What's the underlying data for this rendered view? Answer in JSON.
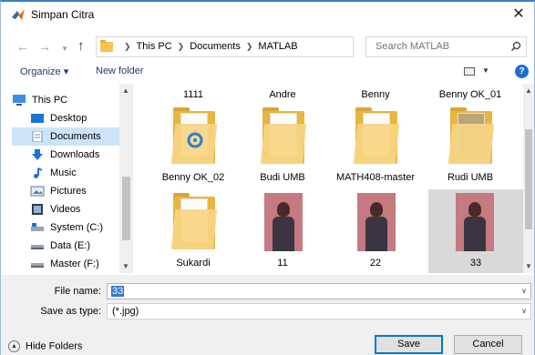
{
  "window": {
    "title": "Simpan Citra"
  },
  "address": {
    "crumbs": [
      "This PC",
      "Documents",
      "MATLAB"
    ],
    "search_placeholder": "Search MATLAB"
  },
  "toolbar": {
    "organize_label": "Organize ▾",
    "new_folder_label": "New folder"
  },
  "nav": {
    "items": [
      {
        "label": "This PC"
      },
      {
        "label": "Desktop"
      },
      {
        "label": "Documents"
      },
      {
        "label": "Downloads"
      },
      {
        "label": "Music"
      },
      {
        "label": "Pictures"
      },
      {
        "label": "Videos"
      },
      {
        "label": "System (C:)"
      },
      {
        "label": "Data (E:)"
      },
      {
        "label": "Master (F:)"
      }
    ]
  },
  "files": {
    "top_row_labels": [
      "1111",
      "Andre",
      "Benny",
      "Benny OK_01"
    ],
    "tiles": [
      {
        "name": "Benny OK_02",
        "kind": "folder"
      },
      {
        "name": "Budi UMB",
        "kind": "folder"
      },
      {
        "name": "MATH408-master",
        "kind": "folder"
      },
      {
        "name": "Rudi UMB",
        "kind": "folder"
      },
      {
        "name": "Sukardi",
        "kind": "folder"
      },
      {
        "name": "11",
        "kind": "image"
      },
      {
        "name": "22",
        "kind": "image"
      },
      {
        "name": "33",
        "kind": "image"
      }
    ]
  },
  "form": {
    "filename_label": "File name:",
    "filename_value": "33",
    "savetype_label": "Save as type:",
    "savetype_value": "(*.jpg)"
  },
  "footer": {
    "hide_folders_label": "Hide Folders",
    "save_label": "Save",
    "cancel_label": "Cancel"
  },
  "colors": {
    "accent": "#0078d7",
    "selection": "#cce4f7",
    "folder": "#e8b640"
  }
}
